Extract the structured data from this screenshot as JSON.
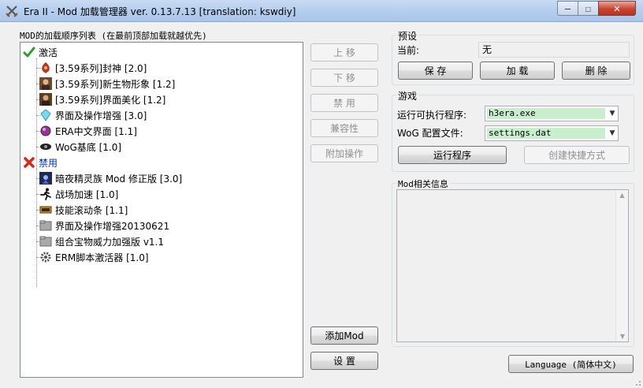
{
  "window": {
    "title": "Era II - Mod 加载管理器 ver. 0.13.7.13 [translation: kswdiy]",
    "controls": {
      "minimize": "—",
      "maximize": "☐",
      "close": "✕"
    }
  },
  "mods": {
    "list_label": "MOD的加载顺序列表 (在最前顶部加载就越优先)",
    "active_group": "激活",
    "active": [
      {
        "label": "[3.59系列]封神 [2.0]",
        "icon": "phoenix-icon"
      },
      {
        "label": "[3.59系列]新生物形象 [1.2]",
        "icon": "portrait-icon"
      },
      {
        "label": "[3.59系列]界面美化 [1.2]",
        "icon": "portrait-icon"
      },
      {
        "label": "界面及操作增强 [3.0]",
        "icon": "crystal-icon"
      },
      {
        "label": "ERA中文界面 [1.1]",
        "icon": "gem-icon"
      },
      {
        "label": "WoG基底 [1.0]",
        "icon": "eye-icon"
      }
    ],
    "disabled_group": "禁用",
    "disabled": [
      {
        "label": "暗夜精灵族 Mod 修正版 [3.0]",
        "icon": "elf-icon"
      },
      {
        "label": "战场加速 [1.0]",
        "icon": "runner-icon"
      },
      {
        "label": "技能滚动条 [1.1]",
        "icon": "scroll-icon"
      },
      {
        "label": "界面及操作增强20130621",
        "icon": "folder-icon"
      },
      {
        "label": "组合宝物威力加强版 v1.1",
        "icon": "folder-icon"
      },
      {
        "label": "ERM脚本激活器 [1.0]",
        "icon": "gear-icon"
      }
    ]
  },
  "side_buttons": {
    "move_up": "上 移",
    "move_down": "下 移",
    "disable": "禁 用",
    "compat": "兼容性",
    "extra_ops": "附加操作",
    "add_mod": "添加Mod",
    "settings": "设 置"
  },
  "preset": {
    "group_title": "预设",
    "current_label": "当前:",
    "current_value": "无",
    "save": "保 存",
    "load": "加 载",
    "delete": "删 除"
  },
  "game": {
    "group_title": "游戏",
    "exe_label": "运行可执行程序:",
    "exe_value": "h3era.exe",
    "config_label": "WoG 配置文件:",
    "config_value": "settings.dat",
    "run": "运行程序",
    "shortcut": "创建快捷方式"
  },
  "info": {
    "group_title": "Mod相关信息"
  },
  "language_button": "Language (简体中文)"
}
